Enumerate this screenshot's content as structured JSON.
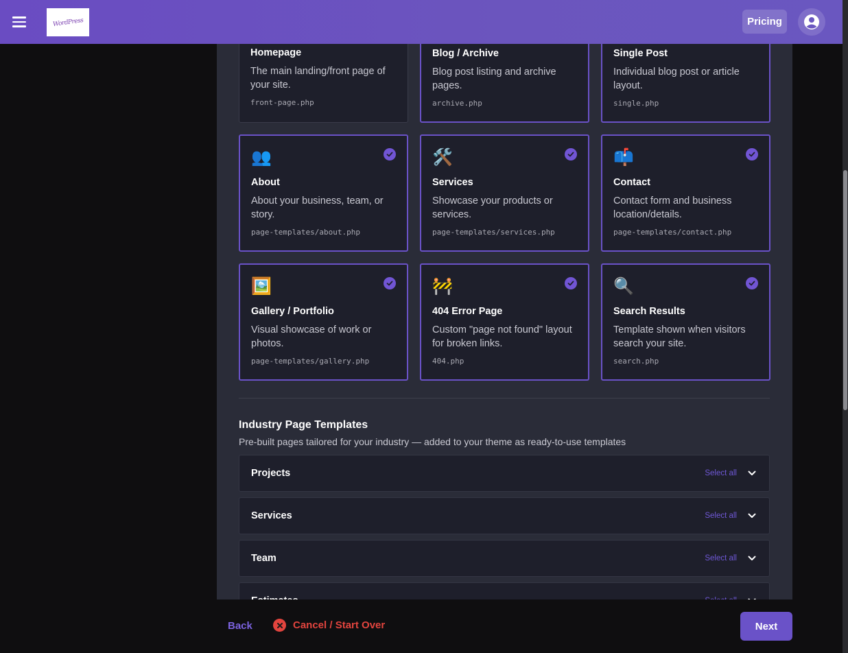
{
  "header": {
    "logo_text": "WordPress",
    "pricing_label": "Pricing"
  },
  "cards": [
    {
      "emoji": "",
      "title": "Homepage",
      "desc": "The main landing/front page of your site.",
      "file": "front-page.php",
      "selected": false
    },
    {
      "emoji": "",
      "title": "Blog / Archive",
      "desc": "Blog post listing and archive pages.",
      "file": "archive.php",
      "selected": true
    },
    {
      "emoji": "",
      "title": "Single Post",
      "desc": "Individual blog post or article layout.",
      "file": "single.php",
      "selected": true
    },
    {
      "emoji": "👥",
      "title": "About",
      "desc": "About your business, team, or story.",
      "file": "page-templates/about.php",
      "selected": true
    },
    {
      "emoji": "🛠️",
      "title": "Services",
      "desc": "Showcase your products or services.",
      "file": "page-templates/services.php",
      "selected": true
    },
    {
      "emoji": "📫",
      "title": "Contact",
      "desc": "Contact form and business location/details.",
      "file": "page-templates/contact.php",
      "selected": true
    },
    {
      "emoji": "🖼️",
      "title": "Gallery / Portfolio",
      "desc": "Visual showcase of work or photos.",
      "file": "page-templates/gallery.php",
      "selected": true
    },
    {
      "emoji": "🚧",
      "title": "404 Error Page",
      "desc": "Custom \"page not found\" layout for broken links.",
      "file": "404.php",
      "selected": true
    },
    {
      "emoji": "🔍",
      "title": "Search Results",
      "desc": "Template shown when visitors search your site.",
      "file": "search.php",
      "selected": true
    }
  ],
  "industry": {
    "title": "Industry Page Templates",
    "subtitle": "Pre-built pages tailored for your industry — added to your theme as ready-to-use templates",
    "select_all_label": "Select all",
    "groups": [
      "Projects",
      "Services",
      "Team",
      "Estimates"
    ]
  },
  "footer": {
    "back_label": "Back",
    "cancel_label": "Cancel / Start Over",
    "next_label": "Next"
  },
  "colors": {
    "accent": "#6a52c8",
    "danger": "#e2443e",
    "panel": "#2a2c38",
    "card": "#1e1f2b"
  }
}
